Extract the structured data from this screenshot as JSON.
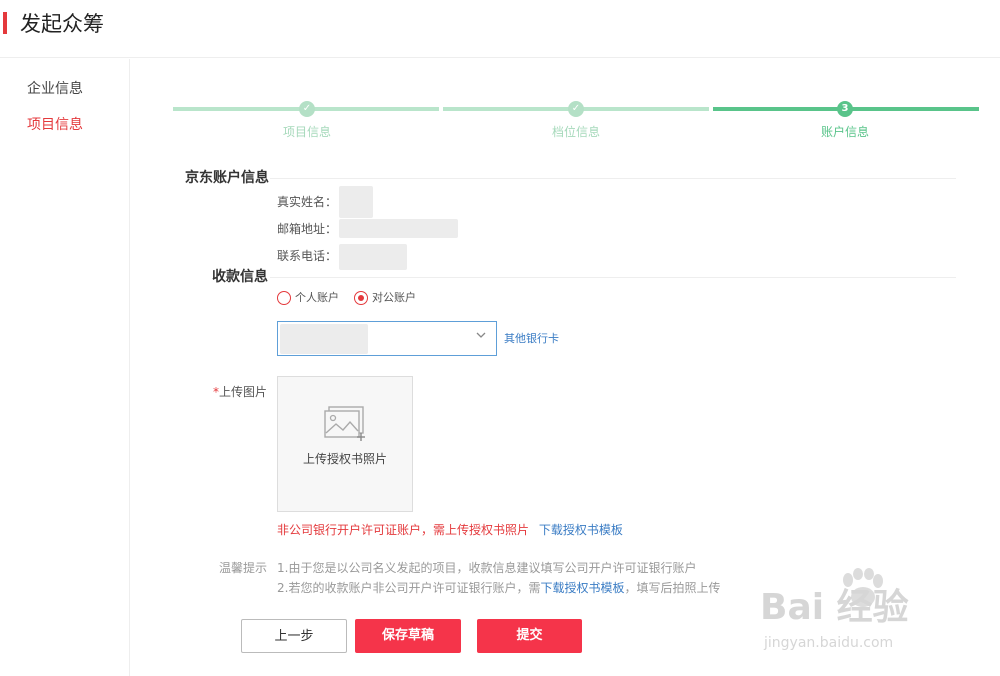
{
  "header": {
    "title": "发起众筹",
    "accent": "#e4393c"
  },
  "sidebar": {
    "items": [
      {
        "label": "企业信息",
        "active": false
      },
      {
        "label": "项目信息",
        "active": true
      }
    ]
  },
  "steps": {
    "items": [
      {
        "number": "✓",
        "label": "项目信息",
        "state": "done"
      },
      {
        "number": "✓",
        "label": "档位信息",
        "state": "done"
      },
      {
        "number": "3",
        "label": "账户信息",
        "state": "current"
      }
    ],
    "done_color": "#b9e5cb",
    "current_color": "#59c48a"
  },
  "account": {
    "title": "京东账户信息",
    "name_label": "真实姓名：",
    "email_label": "邮箱地址：",
    "phone_label": "联系电话："
  },
  "payment": {
    "title": "收款信息",
    "radio_personal": "个人账户",
    "radio_corporate": "对公账户",
    "selected": "对公账户",
    "dropdown_icon": "chevron-down-icon",
    "other_bank_link": "其他银行卡"
  },
  "upload": {
    "required_mark": "*",
    "label": "上传图片",
    "box_text": "上传授权书照片",
    "icon": "image-add-icon",
    "warning_text": "非公司银行开户许可证账户，需上传授权书照片",
    "download_link": "下载授权书模板"
  },
  "tips": {
    "label": "温馨提示",
    "line1": "1.由于您是以公司名义发起的项目，收款信息建议填写公司开户许可证银行账户",
    "line2_before": "2.若您的收款账户非公司开户许可证银行账户，需",
    "line2_link": "下载授权书模板",
    "line2_after": "，填写后拍照上传"
  },
  "buttons": {
    "prev": "上一步",
    "save": "保存草稿",
    "submit": "提交",
    "primary_color": "#f5344a"
  },
  "watermark": {
    "main": "Bai  经验",
    "sub": "jingyan.baidu.com"
  }
}
